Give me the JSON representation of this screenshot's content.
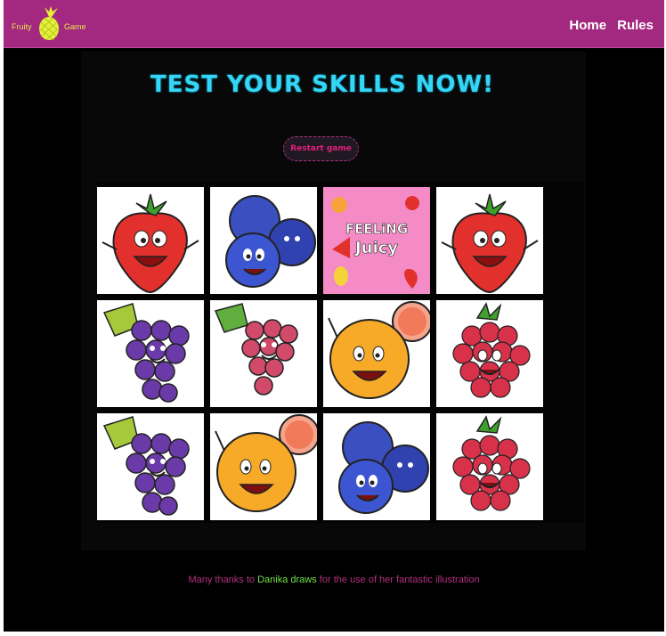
{
  "nav": {
    "logo_word_1": "Fruity",
    "logo_word_2": "Game",
    "home_label": "Home",
    "rules_label": "Rules"
  },
  "main": {
    "title": "TEST YOUR SKILLS NOW!",
    "restart_label": "Restart game"
  },
  "board": {
    "cards": [
      {
        "fruit": "strawberry"
      },
      {
        "fruit": "blueberries"
      },
      {
        "fruit": "feeling-juicy-poster",
        "text_1": "FEELiNG",
        "text_2": "Juicy"
      },
      {
        "fruit": "strawberry"
      },
      {
        "fruit": "grapes-purple"
      },
      {
        "fruit": "grapes-red"
      },
      {
        "fruit": "orange"
      },
      {
        "fruit": "raspberry"
      },
      {
        "fruit": "grapes-purple"
      },
      {
        "fruit": "orange"
      },
      {
        "fruit": "blueberries"
      },
      {
        "fruit": "raspberry"
      }
    ]
  },
  "footer": {
    "text_before": "Many thanks to",
    "link_label": "Danika draws",
    "text_after": "for the use of her fantastic illustration"
  },
  "colors": {
    "navbar": "#a3287f",
    "title": "#34d6f5",
    "restart_text": "#e0207a",
    "footer_text": "#b2317f",
    "footer_link": "#72e24a"
  }
}
